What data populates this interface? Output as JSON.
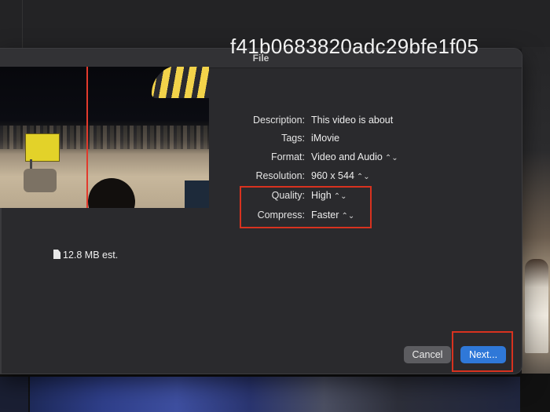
{
  "dialog": {
    "title": "File"
  },
  "file": {
    "name": "f41b0683820adc29bfe1f05",
    "size_estimate": "12.8 MB est."
  },
  "fields": [
    {
      "label": "Description:",
      "value": "This video is about",
      "stepper": false
    },
    {
      "label": "Tags:",
      "value": "iMovie",
      "stepper": false
    },
    {
      "label": "Format:",
      "value": "Video and Audio",
      "stepper": true
    },
    {
      "label": "Resolution:",
      "value": "960 x 544",
      "stepper": true
    },
    {
      "label": "Quality:",
      "value": "High",
      "stepper": true
    },
    {
      "label": "Compress:",
      "value": "Faster",
      "stepper": true
    }
  ],
  "buttons": {
    "cancel": "Cancel",
    "next": "Next..."
  },
  "colors": {
    "accent": "#2f78d8",
    "highlight": "#d8321f"
  },
  "icons": {
    "stepper": "⌃⌄",
    "document": "document-icon"
  }
}
